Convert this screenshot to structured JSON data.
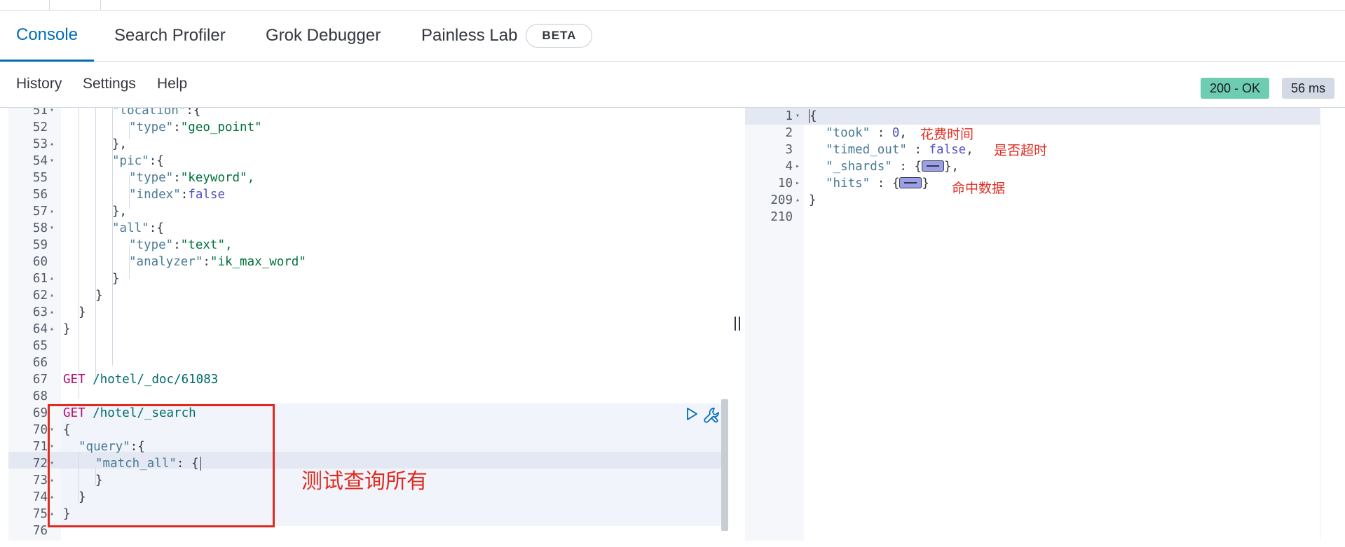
{
  "tabs": {
    "console": "Console",
    "search_profiler": "Search Profiler",
    "grok_debugger": "Grok Debugger",
    "painless_lab": "Painless Lab",
    "beta_badge": "BETA"
  },
  "toolbar": {
    "history": "History",
    "settings": "Settings",
    "help": "Help",
    "status": "200 - OK",
    "duration": "56 ms"
  },
  "editor": {
    "lines": [
      {
        "n": "51",
        "fold": "▾"
      },
      {
        "n": "52",
        "fold": ""
      },
      {
        "n": "53",
        "fold": "▴"
      },
      {
        "n": "54",
        "fold": "▾"
      },
      {
        "n": "55",
        "fold": ""
      },
      {
        "n": "56",
        "fold": ""
      },
      {
        "n": "57",
        "fold": "▴"
      },
      {
        "n": "58",
        "fold": "▾"
      },
      {
        "n": "59",
        "fold": ""
      },
      {
        "n": "60",
        "fold": ""
      },
      {
        "n": "61",
        "fold": "▴"
      },
      {
        "n": "62",
        "fold": "▴"
      },
      {
        "n": "63",
        "fold": "▴"
      },
      {
        "n": "64",
        "fold": "▴"
      },
      {
        "n": "65",
        "fold": ""
      },
      {
        "n": "66",
        "fold": ""
      },
      {
        "n": "67",
        "fold": ""
      },
      {
        "n": "68",
        "fold": ""
      },
      {
        "n": "69",
        "fold": ""
      },
      {
        "n": "70",
        "fold": "▾"
      },
      {
        "n": "71",
        "fold": "▾"
      },
      {
        "n": "72",
        "fold": "▾"
      },
      {
        "n": "73",
        "fold": "▴"
      },
      {
        "n": "74",
        "fold": "▴"
      },
      {
        "n": "75",
        "fold": "▴"
      },
      {
        "n": "76",
        "fold": ""
      }
    ],
    "code": {
      "l51_key": "\"location\"",
      "l51_rest": ":{",
      "type_key": "\"type\"",
      "geo_point": "\"geo_point\"",
      "close_comma": "},",
      "pic_key": "\"pic\"",
      "open_brace_colon": ":{",
      "keyword": "\"keyword\",",
      "index_key": "\"index\"",
      "false_val": "false",
      "all_key": "\"all\"",
      "text_val": "\"text\",",
      "analyzer_key": "\"analyzer\"",
      "ik_max_word": "\"ik_max_word\"",
      "close": "}",
      "colon": ":",
      "get": "GET",
      "doc_url": "/hotel/_doc/61083",
      "search_url": "/hotel/_search",
      "open": "{",
      "query_key": "\"query\"",
      "match_all_key": "\"match_all\"",
      "match_all_rest": ": {"
    },
    "annotation": "测试查询所有"
  },
  "output": {
    "lines": [
      {
        "n": "1",
        "fold": "▾"
      },
      {
        "n": "2",
        "fold": ""
      },
      {
        "n": "3",
        "fold": ""
      },
      {
        "n": "4",
        "fold": "▸"
      },
      {
        "n": "10",
        "fold": "▸"
      },
      {
        "n": "209",
        "fold": "▴"
      },
      {
        "n": "210",
        "fold": ""
      }
    ],
    "code": {
      "open": "{",
      "took_key": "\"took\"",
      "sep": " : ",
      "took_val": "0",
      "comma": ",",
      "timed_out_key": "\"timed_out\"",
      "timed_out_val": "false",
      "shards_key": "\"_shards\"",
      "hits_key": "\"hits\"",
      "brace_open": "{",
      "brace_close_comma": "},",
      "brace_close": "}",
      "close": "}"
    },
    "annotations": {
      "took": "花费时间",
      "timed_out": "是否超时",
      "hits": "命中数据"
    }
  },
  "colors": {
    "accent": "#006bb8",
    "status_ok": "#6dccb1",
    "annotation_red": "#e02b20",
    "method": "#b5106d"
  }
}
